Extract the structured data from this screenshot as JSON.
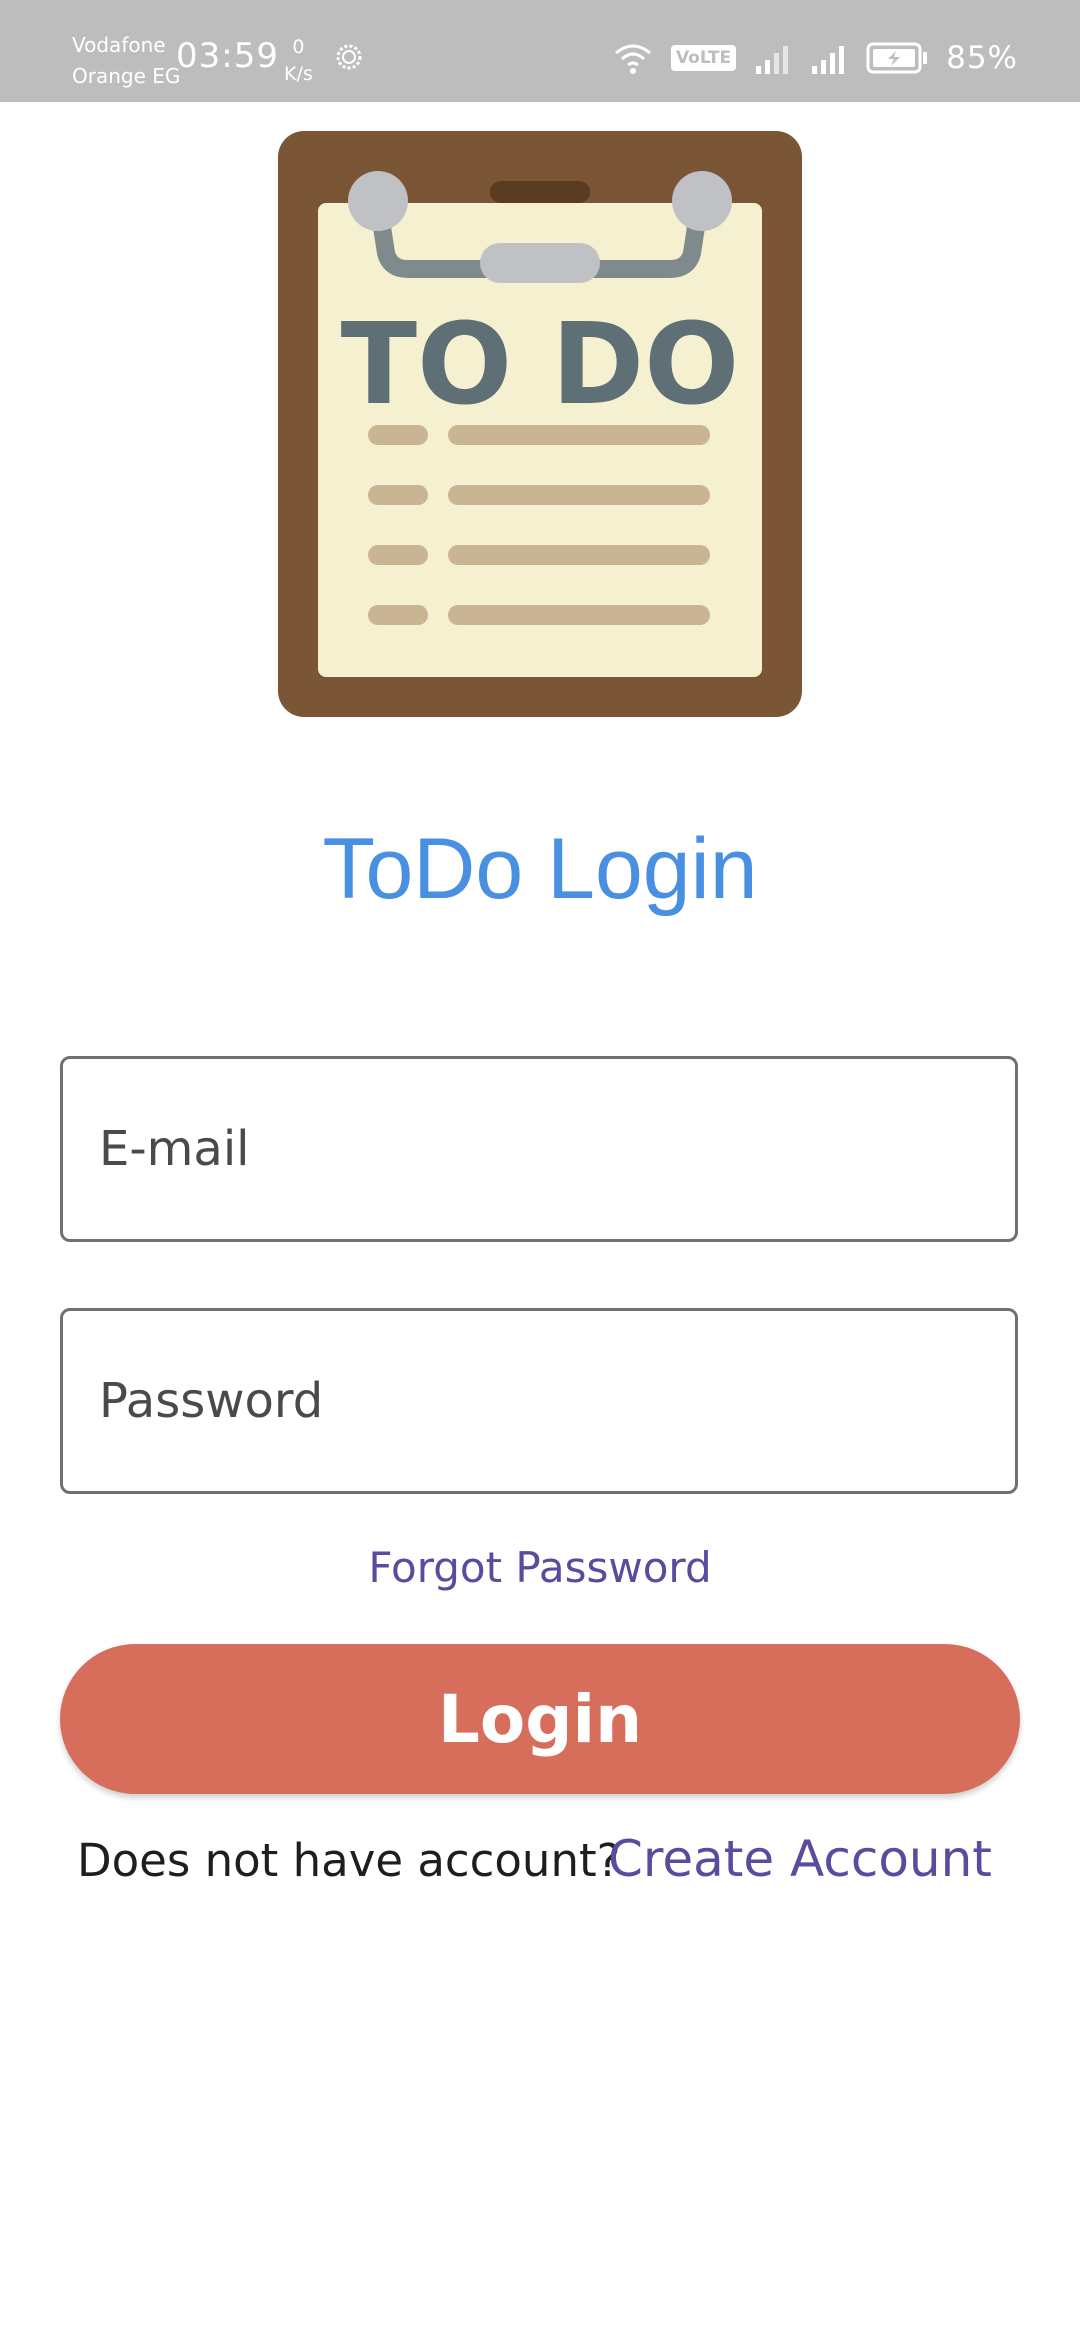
{
  "status_bar": {
    "carrier_line1": "Vodafone",
    "carrier_line2": "Orange EG",
    "time": "03:59",
    "net_speed_value": "0",
    "net_speed_unit": "K/s",
    "volte_label": "VoLTE",
    "battery_percent": "85%"
  },
  "logo": {
    "text": "TO DO"
  },
  "title": "ToDo Login",
  "form": {
    "email_placeholder": "E-mail",
    "password_placeholder": "Password",
    "forgot_password": "Forgot Password",
    "login_button": "Login"
  },
  "footer": {
    "no_account_text": "Does not have account?",
    "create_account": "Create Account"
  },
  "colors": {
    "status_bar_bg": "#bdbdbd",
    "title": "#4a90e2",
    "link": "#5b4a9e",
    "button": "#d76e5b"
  }
}
